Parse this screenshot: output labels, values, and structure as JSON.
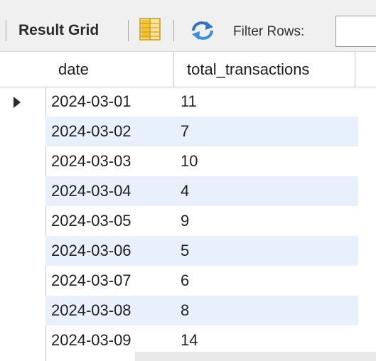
{
  "toolbar": {
    "title": "Result Grid",
    "filter_label": "Filter Rows:",
    "filter_value": "",
    "icons": [
      "form-grid-icon",
      "refresh-icon"
    ]
  },
  "grid": {
    "columns": [
      "date",
      "total_transactions"
    ],
    "rows": [
      {
        "date": "2024-03-01",
        "total_transactions": "11"
      },
      {
        "date": "2024-03-02",
        "total_transactions": "7"
      },
      {
        "date": "2024-03-03",
        "total_transactions": "10"
      },
      {
        "date": "2024-03-04",
        "total_transactions": "4"
      },
      {
        "date": "2024-03-05",
        "total_transactions": "9"
      },
      {
        "date": "2024-03-06",
        "total_transactions": "5"
      },
      {
        "date": "2024-03-07",
        "total_transactions": "6"
      },
      {
        "date": "2024-03-08",
        "total_transactions": "8"
      },
      {
        "date": "2024-03-09",
        "total_transactions": "14"
      }
    ],
    "selected_row": 0,
    "colors": {
      "alt_row": "#e8f0fb",
      "icon_yellow": "#f2c233",
      "icon_blue": "#2f73c8"
    }
  }
}
